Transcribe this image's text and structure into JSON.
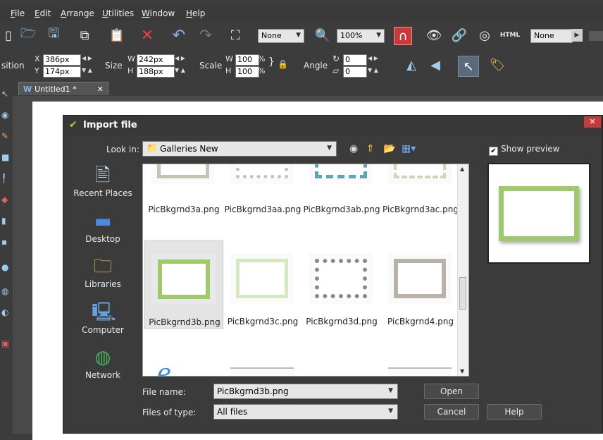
{
  "menu": [
    "File",
    "Edit",
    "Arrange",
    "Utilities",
    "Window",
    "Help"
  ],
  "toolbar": {
    "zoom_select_1": "None",
    "zoom_percent": "100%",
    "html_label": "HTML",
    "none_select_2": "None"
  },
  "infobar": {
    "position_label": "sition",
    "x_label": "X",
    "x_value": "386px",
    "y_label": "Y",
    "y_value": "174px",
    "size_label": "Size",
    "w_label": "W",
    "w_value": "242px",
    "h_label": "H",
    "h_value": "188px",
    "scale_label": "Scale",
    "sw_label": "W",
    "sw_value": "100",
    "sh_label": "H",
    "sh_value": "100",
    "percent": "%",
    "angle_label": "Angle",
    "angle_value": "0",
    "skew_value": "0"
  },
  "document_tab": {
    "label": "Untitled1 *",
    "close": "✕"
  },
  "dialog": {
    "title": "Import file",
    "close": "✕",
    "look_in_label": "Look in:",
    "look_in_value": "Galleries New",
    "show_preview": "Show preview",
    "places": [
      "Recent Places",
      "Desktop",
      "Libraries",
      "Computer",
      "Network"
    ],
    "files_row1": [
      "PicBkgrnd3a.png",
      "PicBkgrnd3aa.png",
      "PicBkgrnd3ab.png",
      "PicBkgrnd3ac.png"
    ],
    "files_row2": [
      "PicBkgrnd3b.png",
      "PicBkgrnd3c.png",
      "PicBkgrnd3d.png",
      "PicBkgrnd4.png"
    ],
    "file_name_label": "File name:",
    "file_name_value": "PicBkgrnd3b.png",
    "file_type_label": "Files of type:",
    "file_type_value": "All files",
    "open_button": "Open",
    "cancel_button": "Cancel",
    "help_button": "Help"
  },
  "colors": {
    "accent_green": "#9fc96a",
    "close_red": "#c43b3b",
    "dialog_bg": "#3b3b3b"
  }
}
